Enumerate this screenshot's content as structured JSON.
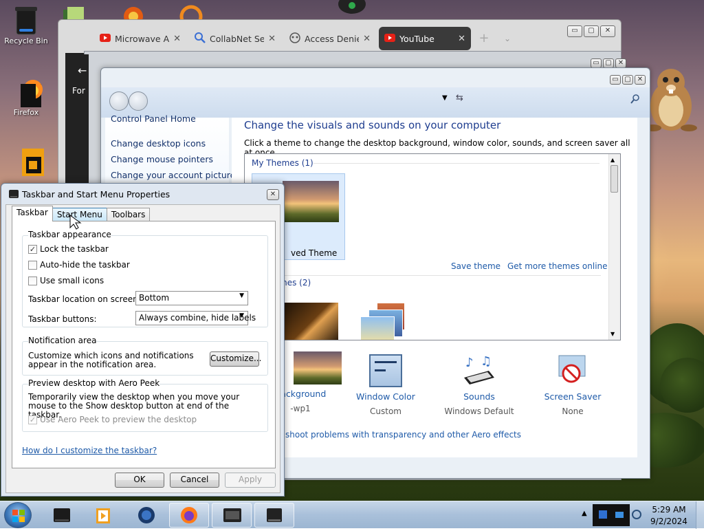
{
  "desktop": {
    "icons": [
      {
        "label": "Recycle Bin"
      },
      {
        "label": "Firefox"
      }
    ]
  },
  "browser": {
    "tabs": [
      {
        "label": "Microwave Anc",
        "icon": "youtube-icon"
      },
      {
        "label": "CollabNet Sear",
        "icon": "search-icon"
      },
      {
        "label": "Access Denied",
        "icon": "broken-page-icon"
      },
      {
        "label": "YouTube",
        "icon": "youtube-icon",
        "active": true
      }
    ],
    "close_glyph": "✕",
    "new_tab_glyph": "+",
    "dropdown_glyph": "⌄",
    "window_controls": {
      "minimize": "▭",
      "maximize": "▢",
      "close": "✕"
    }
  },
  "midwin": {
    "left_label": "For"
  },
  "control_panel": {
    "sidebar": {
      "links": [
        "Control Panel Home",
        "Change desktop icons",
        "Change mouse pointers",
        "Change your account picture"
      ]
    },
    "heading": "Change the visuals and sounds on your computer",
    "subheading": "Click a theme to change the desktop background, window color, sounds, and screen saver all at once.",
    "my_themes_label": "My Themes (1)",
    "saved_theme_label": "ved Theme",
    "save_theme_link": "Save theme",
    "get_more_link": "Get more themes online",
    "aero_themes_label": "mes (2)",
    "bottom_items": [
      {
        "title": "Background",
        "sub": "-wp1"
      },
      {
        "title": "Window Color",
        "sub": "Custom"
      },
      {
        "title": "Sounds",
        "sub": "Windows Default"
      },
      {
        "title": "Screen Saver",
        "sub": "None"
      }
    ],
    "troubleshoot_link": "shoot problems with transparency and other Aero effects"
  },
  "dialog": {
    "title": "Taskbar and Start Menu Properties",
    "close_glyph": "✕",
    "tabs": [
      "Taskbar",
      "Start Menu",
      "Toolbars"
    ],
    "appearance": {
      "legend": "Taskbar appearance",
      "lock": {
        "label": "Lock the taskbar",
        "checked": true
      },
      "autohide": {
        "label": "Auto-hide the taskbar",
        "checked": false
      },
      "small_icons": {
        "label": "Use small icons",
        "checked": false
      },
      "location_label": "Taskbar location on screen:",
      "location_value": "Bottom",
      "buttons_label": "Taskbar buttons:",
      "buttons_value": "Always combine, hide labels"
    },
    "notification": {
      "legend": "Notification area",
      "text": "Customize which icons and notifications appear in the notification area.",
      "button": "Customize..."
    },
    "aero_peek": {
      "legend": "Preview desktop with Aero Peek",
      "text": "Temporarily view the desktop when you move your mouse to the Show desktop button at end of the taskbar.",
      "checkbox": {
        "label": "Use Aero Peek to preview the desktop",
        "checked": true,
        "disabled": true
      }
    },
    "help_link": "How do I customize the taskbar?",
    "ok": "OK",
    "cancel": "Cancel",
    "apply": "Apply",
    "check_glyph": "✓",
    "dropdown_arrow": "▼"
  },
  "taskbar": {
    "time": "5:29 AM",
    "date": "9/2/2024"
  }
}
